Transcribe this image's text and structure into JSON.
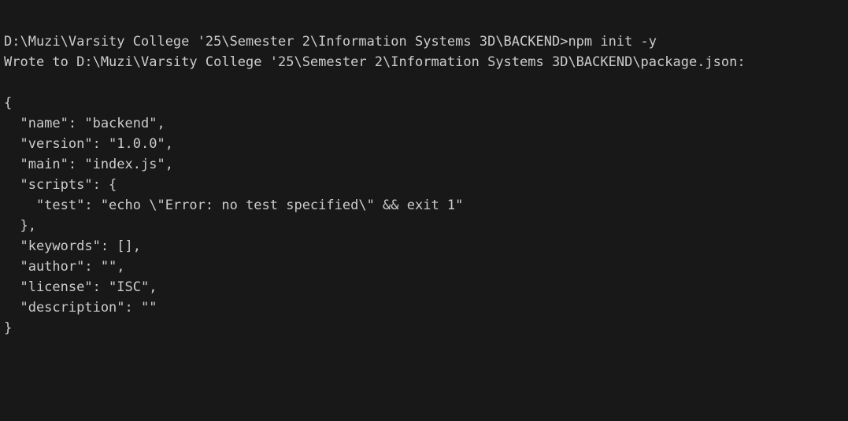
{
  "terminal": {
    "lines": [
      "D:\\Muzi\\Varsity College '25\\Semester 2\\Information Systems 3D\\BACKEND>npm init -y",
      "Wrote to D:\\Muzi\\Varsity College '25\\Semester 2\\Information Systems 3D\\BACKEND\\package.json:",
      "",
      "{",
      "  \"name\": \"backend\",",
      "  \"version\": \"1.0.0\",",
      "  \"main\": \"index.js\",",
      "  \"scripts\": {",
      "    \"test\": \"echo \\\"Error: no test specified\\\" && exit 1\"",
      "  },",
      "  \"keywords\": [],",
      "  \"author\": \"\",",
      "  \"license\": \"ISC\",",
      "  \"description\": \"\"",
      "}"
    ],
    "colors": {
      "background": "#181818",
      "text": "#cccccc"
    }
  }
}
